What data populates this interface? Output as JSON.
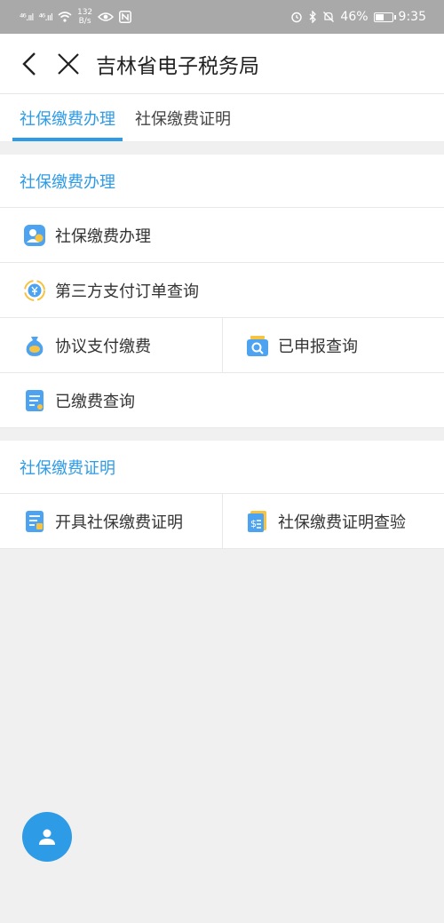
{
  "status_bar": {
    "signal1": "⁴⁶.ııl",
    "signal2": "⁴⁶.ııl",
    "speed_value": "132",
    "speed_unit": "B/s",
    "battery": "46%",
    "time": "9:35"
  },
  "header": {
    "title": "吉林省电子税务局"
  },
  "tabs": [
    {
      "label": "社保缴费办理",
      "active": true
    },
    {
      "label": "社保缴费证明",
      "active": false
    }
  ],
  "sections": [
    {
      "title": "社保缴费办理",
      "items": [
        {
          "label": "社保缴费办理",
          "icon": "person-coin-icon"
        },
        {
          "label": "第三方支付订单查询",
          "icon": "yuan-cycle-icon"
        },
        {
          "label": "协议支付缴费",
          "icon": "money-bag-icon"
        },
        {
          "label": "已申报查询",
          "icon": "search-folder-icon"
        },
        {
          "label": "已缴费查询",
          "icon": "document-list-icon"
        }
      ]
    },
    {
      "title": "社保缴费证明",
      "items": [
        {
          "label": "开具社保缴费证明",
          "icon": "certificate-doc-icon"
        },
        {
          "label": "社保缴费证明查验",
          "icon": "dollar-doc-icon"
        }
      ]
    }
  ],
  "colors": {
    "accent": "#2e9be6",
    "status_bar": "#a9a9a9"
  }
}
